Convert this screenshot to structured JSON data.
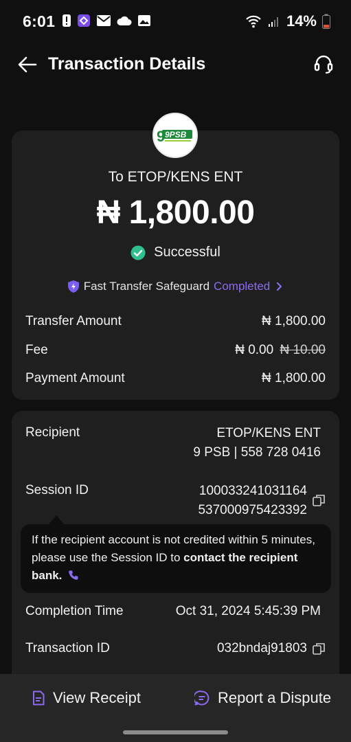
{
  "status_bar": {
    "time": "6:01",
    "battery": "14%"
  },
  "header": {
    "title": "Transaction Details"
  },
  "summary": {
    "bank_logo_text": "9PSB",
    "to_line": "To ETOP/KENS ENT",
    "amount": "₦ 1,800.00",
    "status": "Successful",
    "safeguard_label": "Fast Transfer Safeguard",
    "safeguard_status": "Completed"
  },
  "amounts": {
    "transfer_label": "Transfer Amount",
    "transfer_value": "₦ 1,800.00",
    "fee_label": "Fee",
    "fee_value": "₦ 0.00",
    "fee_original": "₦ 10.00",
    "payment_label": "Payment Amount",
    "payment_value": "₦ 1,800.00"
  },
  "details": {
    "recipient_label": "Recipient",
    "recipient_name": "ETOP/KENS ENT",
    "recipient_account": "9 PSB | 558 728 0416",
    "session_label": "Session ID",
    "session_line1": "100033241031164",
    "session_line2": "537000975423392",
    "tooltip_text": "If the recipient account is not credited within 5 minutes, please use the Session ID to ",
    "tooltip_link": "contact the recipient bank.",
    "completion_label": "Completion Time",
    "completion_value": "Oct 31, 2024 5:45:39 PM",
    "txn_label": "Transaction ID",
    "txn_value": "032bndaj91803"
  },
  "actions": {
    "view_receipt": "View Receipt",
    "report_dispute": "Report a Dispute"
  },
  "colors": {
    "accent": "#8b6cf0",
    "success": "#2fbf8f",
    "background": "#101010",
    "card": "#1f1f1f"
  }
}
